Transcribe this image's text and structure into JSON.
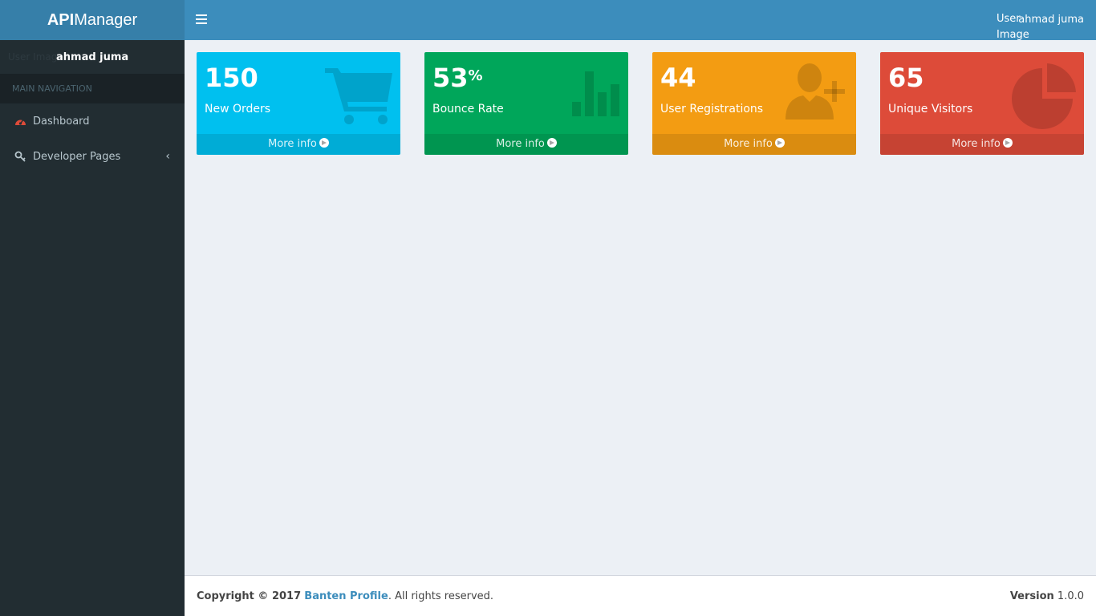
{
  "brand": {
    "bold": "API",
    "rest": "Manager"
  },
  "sidebar": {
    "user_image_alt": "User Image",
    "user_name": "ahmad juma",
    "nav_header": "MAIN NAVIGATION",
    "items": [
      {
        "label": "Dashboard",
        "icon": "dashboard-icon"
      },
      {
        "label": "Developer Pages",
        "icon": "key-icon"
      }
    ]
  },
  "header": {
    "user_image_alt": "User Image",
    "user_name": "ahmad juma"
  },
  "boxes": [
    {
      "value": "150",
      "suffix": "",
      "label": "New Orders",
      "more": "More info",
      "color": "#00c0ef",
      "icon": "shopping-cart-icon"
    },
    {
      "value": "53",
      "suffix": "%",
      "label": "Bounce Rate",
      "more": "More info",
      "color": "#00a65a",
      "icon": "bar-chart-icon"
    },
    {
      "value": "44",
      "suffix": "",
      "label": "User Registrations",
      "more": "More info",
      "color": "#f39c12",
      "icon": "user-plus-icon"
    },
    {
      "value": "65",
      "suffix": "",
      "label": "Unique Visitors",
      "more": "More info",
      "color": "#dd4b39",
      "icon": "pie-chart-icon"
    }
  ],
  "footer": {
    "copyright": "Copyright © 2017",
    "company": "Banten Profile",
    "rights": ". All rights reserved.",
    "version_label": "Version",
    "version": "1.0.0"
  },
  "colors": {
    "header": "#3c8dbc",
    "logo": "#367fa9",
    "sidebar": "#222d32",
    "content": "#ecf0f5"
  }
}
